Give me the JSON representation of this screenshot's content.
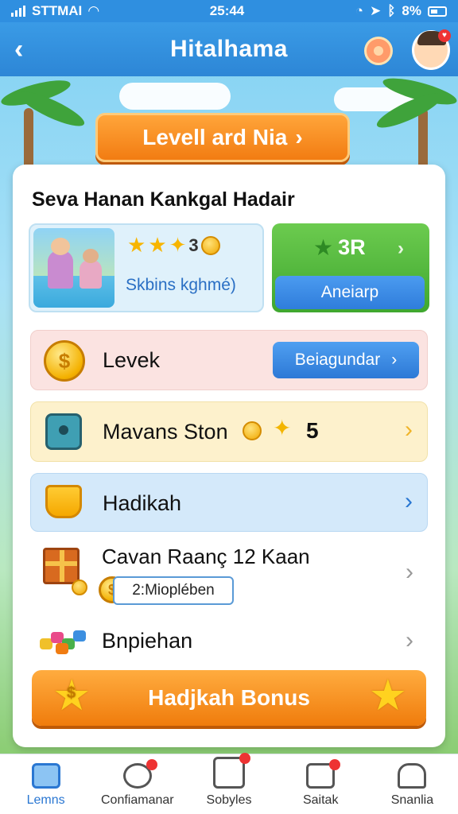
{
  "status_bar": {
    "carrier": "STTMAI",
    "time": "25:44",
    "battery": "8%"
  },
  "header": {
    "title": "Hitalhama"
  },
  "level_button": {
    "label": "Levell ard Nia",
    "chevron": "›"
  },
  "card": {
    "title": "Seva Hanan Kankgal Hadair",
    "promo": {
      "count": "3",
      "subtitle": "Skbins kghmé)"
    },
    "green_box": {
      "value": "3R",
      "chevron": "›",
      "button_label": "Aneiarp"
    },
    "rows": [
      {
        "label": "Levek",
        "button_label": "Beiagundar",
        "chevron": "›",
        "icon": "coin-icon"
      },
      {
        "label": "Mavans Ston",
        "value": "5",
        "chevron": "›",
        "icon": "cube-icon"
      },
      {
        "label": "Hadikah",
        "chevron": "›",
        "icon": "pot-icon"
      },
      {
        "label": "Cavan Raanç 12 Kaan",
        "tag": "2:Mioplében",
        "chevron": "›",
        "icon": "gift-icon"
      },
      {
        "label": "Bnpiehan",
        "chevron": "›",
        "icon": "gems-icon"
      }
    ],
    "bonus_button": {
      "label": "Hadjkah Bonus"
    }
  },
  "tab_bar": {
    "tabs": [
      {
        "label": "Lemns",
        "icon": "home-icon",
        "active": true
      },
      {
        "label": "Confiamanar",
        "icon": "chat-icon",
        "active": false
      },
      {
        "label": "Sobyles",
        "icon": "tablet-icon",
        "active": false
      },
      {
        "label": "Saitak",
        "icon": "mail-icon",
        "active": false
      },
      {
        "label": "Snanlia",
        "icon": "list-icon",
        "active": false
      }
    ]
  },
  "colors": {
    "header_blue": "#2f8fe0",
    "orange": "#f27c12",
    "green": "#3fa72f",
    "button_blue": "#2f7ddb"
  }
}
